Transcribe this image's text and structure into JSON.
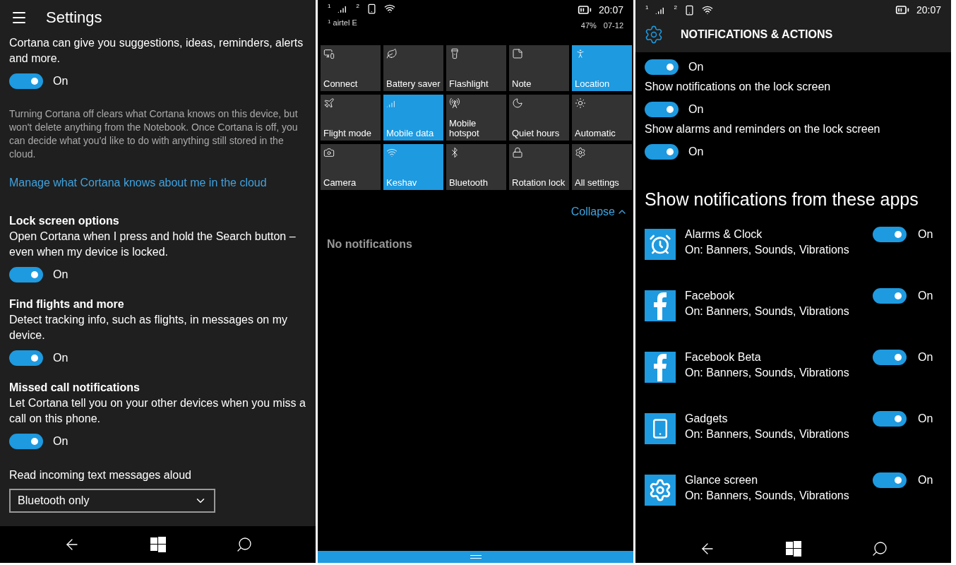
{
  "cortana_settings": {
    "header": {
      "title": "Settings"
    },
    "items": [
      {
        "kind": "text",
        "text": "Cortana can give you suggestions, ideas, reminders, alerts and more."
      },
      {
        "kind": "toggle",
        "on": true,
        "label": "On"
      },
      {
        "kind": "note",
        "text": "Turning Cortana off clears what Cortana knows on this device, but won't delete anything from the Notebook. Once Cortana is off, you can decide what you'd like to do with anything still stored in the cloud."
      },
      {
        "kind": "link",
        "text": "Manage what Cortana knows about me in the cloud"
      },
      {
        "kind": "heading",
        "text": "Lock screen options"
      },
      {
        "kind": "text",
        "text": "Open Cortana when I press and hold the Search button – even when my device is locked."
      },
      {
        "kind": "toggle",
        "on": true,
        "label": "On"
      },
      {
        "kind": "heading",
        "text": "Find flights and more"
      },
      {
        "kind": "text",
        "text": "Detect tracking info, such as flights, in messages on my device."
      },
      {
        "kind": "toggle",
        "on": true,
        "label": "On"
      },
      {
        "kind": "heading",
        "text": "Missed call notifications"
      },
      {
        "kind": "text",
        "text": "Let Cortana tell you on your other devices when you miss a call on this phone."
      },
      {
        "kind": "toggle",
        "on": true,
        "label": "On"
      },
      {
        "kind": "label",
        "text": "Read incoming text messages aloud"
      },
      {
        "kind": "dropdown",
        "value": "Bluetooth only"
      }
    ]
  },
  "action_center": {
    "status_bar": {
      "sim_marks": [
        "1",
        "2"
      ],
      "carrier_mark": "1",
      "carrier": "airtel E",
      "time": "20:07",
      "battery": "47%",
      "date": "07-12"
    },
    "tiles": [
      {
        "label": "Connect",
        "selected": false
      },
      {
        "label": "Battery saver",
        "selected": false
      },
      {
        "label": "Flashlight",
        "selected": false
      },
      {
        "label": "Note",
        "selected": false
      },
      {
        "label": "Location",
        "selected": true
      },
      {
        "label": "Flight mode",
        "selected": false
      },
      {
        "label": "Mobile data",
        "selected": true
      },
      {
        "label": "Mobile hotspot",
        "selected": false
      },
      {
        "label": "Quiet hours",
        "selected": false
      },
      {
        "label": "Automatic",
        "selected": false
      },
      {
        "label": "Camera",
        "selected": false
      },
      {
        "label": "Keshav",
        "selected": true
      },
      {
        "label": "Bluetooth",
        "selected": false
      },
      {
        "label": "Rotation lock",
        "selected": false
      },
      {
        "label": "All settings",
        "selected": false
      }
    ],
    "collapse": "Collapse",
    "empty_message": "No notifications"
  },
  "notifications_settings": {
    "status_bar": {
      "sim_marks": [
        "1",
        "2"
      ],
      "time": "20:07"
    },
    "header": {
      "title": "NOTIFICATIONS & ACTIONS"
    },
    "items": [
      {
        "kind": "toggle",
        "on": true,
        "label": "On"
      },
      {
        "kind": "text",
        "text": "Show notifications on the lock screen"
      },
      {
        "kind": "toggle",
        "on": true,
        "label": "On"
      },
      {
        "kind": "text",
        "text": "Show alarms and reminders on the lock screen"
      },
      {
        "kind": "toggle",
        "on": true,
        "label": "On"
      }
    ],
    "apps_heading": "Show notifications from these apps",
    "apps": [
      {
        "name": "Alarms & Clock",
        "detail": "On: Banners, Sounds, Vibrations",
        "on": true,
        "label": "On"
      },
      {
        "name": "Facebook",
        "detail": "On: Banners, Sounds, Vibrations",
        "on": true,
        "label": "On"
      },
      {
        "name": "Facebook Beta",
        "detail": "On: Banners, Sounds, Vibrations",
        "on": true,
        "label": "On"
      },
      {
        "name": "Gadgets",
        "detail": "On: Banners, Sounds, Vibrations",
        "on": true,
        "label": "On"
      },
      {
        "name": "Glance screen",
        "detail": "On: Banners, Sounds, Vibrations",
        "on": true,
        "label": "On"
      }
    ]
  }
}
